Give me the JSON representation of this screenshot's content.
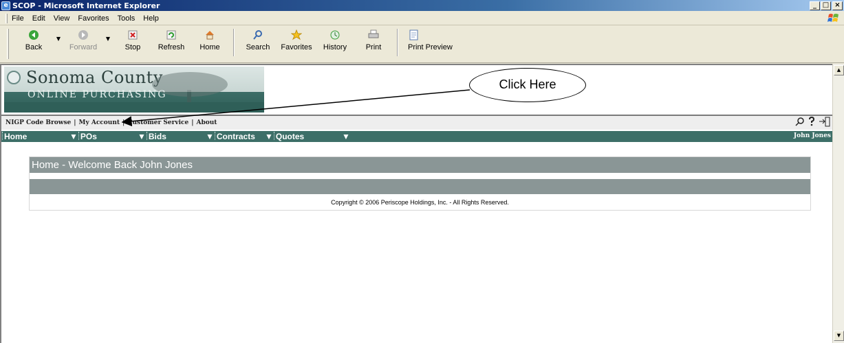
{
  "window": {
    "title": "SCOP - Microsoft Internet Explorer",
    "minimize": "_",
    "maximize": "□",
    "close": "×"
  },
  "menubar": {
    "items": [
      "File",
      "Edit",
      "View",
      "Favorites",
      "Tools",
      "Help"
    ]
  },
  "toolbar": {
    "back": "Back",
    "forward": "Forward",
    "stop": "Stop",
    "refresh": "Refresh",
    "home": "Home",
    "search": "Search",
    "favorites": "Favorites",
    "history": "History",
    "print": "Print",
    "print_preview": "Print Preview"
  },
  "banner": {
    "name": "Sonoma County",
    "subtitle": "ONLINE PURCHASING"
  },
  "callout": {
    "text": "Click Here"
  },
  "links": {
    "nigp": "NIGP Code Browse",
    "account": "My Account",
    "service": "Customer Service",
    "about": "About",
    "separator": "|"
  },
  "nav": {
    "home": "Home",
    "pos": "POs",
    "bids": "Bids",
    "contracts": "Contracts",
    "quotes": "Quotes",
    "user": "John Jones"
  },
  "content": {
    "welcome": "Home - Welcome Back John Jones",
    "copyright": "Copyright © 2006 Periscope Holdings, Inc. - All Rights Reserved."
  },
  "colors": {
    "nav_bg": "#3d6f68",
    "welcome_bg": "#8a9696",
    "titlebar": "#0a246a"
  }
}
